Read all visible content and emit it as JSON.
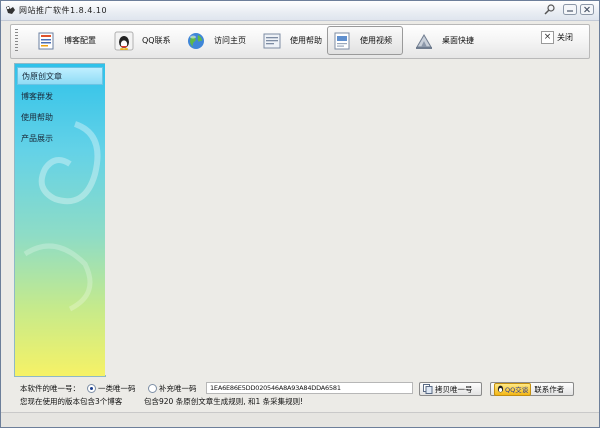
{
  "window": {
    "title": "网站推广软件1.8.4.10"
  },
  "toolbar": {
    "items": [
      {
        "label": "博客配置",
        "icon": "blog-config-icon"
      },
      {
        "label": "QQ联系",
        "icon": "qq-penguin-icon"
      },
      {
        "label": "访问主页",
        "icon": "globe-icon"
      },
      {
        "label": "使用帮助",
        "icon": "help-doc-icon"
      },
      {
        "label": "使用视频",
        "icon": "video-doc-icon",
        "active": true
      },
      {
        "label": "桌面快捷",
        "icon": "desktop-shortcut-icon"
      }
    ],
    "close_label": "关闭"
  },
  "sidebar": {
    "items": [
      {
        "label": "伪原创文章",
        "selected": true
      },
      {
        "label": "博客群发"
      },
      {
        "label": "使用帮助"
      },
      {
        "label": "产品展示"
      }
    ]
  },
  "footer": {
    "id_label": "本软件的唯一号：",
    "radio_primary": "一类唯一码",
    "radio_secondary": "补充唯一码",
    "code": "1EA6E86E5DD020546A8A93A84DDA6581",
    "copy_button": "拷贝唯一号",
    "contact_badge": "QQ交谈",
    "contact_button": "联系作者",
    "version_note": "您现在使用的版本包含3个博客",
    "rules_note": "包含920 条原创文章生成规则, 和1 条采集规则!"
  },
  "colors": {
    "accent_sidebar_top": "#2fc2ea",
    "accent_sidebar_bottom": "#f6f266"
  }
}
